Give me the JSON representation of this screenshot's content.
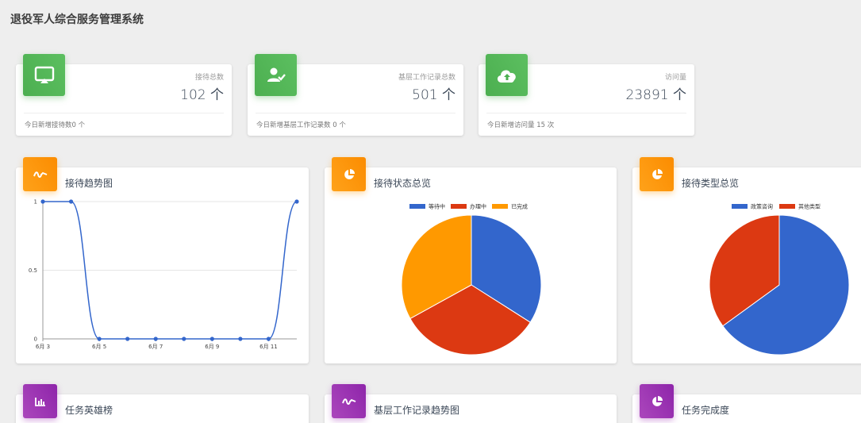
{
  "app": {
    "title": "退役军人综合服务管理系统"
  },
  "stats": [
    {
      "label": "接待总数",
      "value": "102 个",
      "footer": "今日新增接待数0 个",
      "icon": "monitor-icon"
    },
    {
      "label": "基层工作记录总数",
      "value": "501 个",
      "footer": "今日新增基层工作记录数 0 个",
      "icon": "user-check-icon"
    },
    {
      "label": "访问量",
      "value": "23891 个",
      "footer": "今日新增访问量 15 次",
      "icon": "cloud-upload-icon"
    }
  ],
  "cards": {
    "trend": {
      "title": "接待趋势图",
      "icon": "trend-icon"
    },
    "status": {
      "title": "接待状态总览",
      "icon": "pie-icon"
    },
    "type": {
      "title": "接待类型总览",
      "icon": "pie-icon"
    },
    "hero": {
      "title": "任务英雄榜",
      "icon": "bar-chart-icon"
    },
    "grassroots": {
      "title": "基层工作记录趋势图",
      "icon": "trend-icon"
    },
    "completion": {
      "title": "任务完成度",
      "icon": "pie-icon"
    }
  },
  "colors": {
    "green": "#4caf50",
    "orange": "#ff9800",
    "purple": "#9c27b0",
    "blue": "#3366cc",
    "red": "#dc3912",
    "yellow": "#ff9900"
  },
  "chart_data": [
    {
      "type": "line",
      "x": [
        "6月 3",
        "6月 4",
        "6月 5",
        "6月 6",
        "6月 7",
        "6月 8",
        "6月 9",
        "6月 10",
        "6月 11",
        "6月 12"
      ],
      "xticks": [
        "6月 3",
        "6月 5",
        "6月 7",
        "6月 9",
        "6月 11"
      ],
      "yticks": [
        "0",
        "0.5",
        "1"
      ],
      "values": [
        1,
        1,
        0,
        0,
        0,
        0,
        0,
        0,
        0,
        1
      ],
      "ylim": [
        0,
        1
      ],
      "grid": true
    },
    {
      "type": "pie",
      "labels": [
        "等待中",
        "办理中",
        "已完成"
      ],
      "values": [
        34,
        33,
        33
      ],
      "colors": [
        "#3366cc",
        "#dc3912",
        "#ff9900"
      ],
      "legend": "top"
    },
    {
      "type": "pie",
      "labels": [
        "政策咨询",
        "其他类型"
      ],
      "values": [
        65,
        35
      ],
      "colors": [
        "#3366cc",
        "#dc3912"
      ],
      "legend": "top"
    }
  ]
}
